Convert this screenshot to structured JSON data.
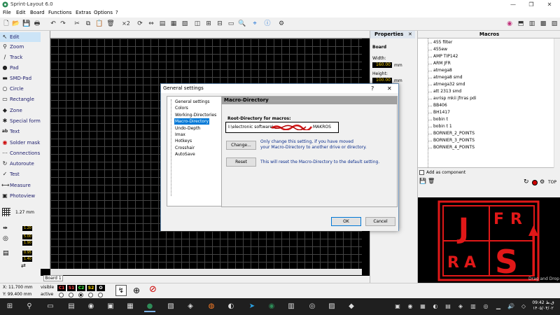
{
  "window": {
    "title": "Sprint-Layout 6.0"
  },
  "menu": [
    "File",
    "Edit",
    "Board",
    "Functions",
    "Extras",
    "Options",
    "?"
  ],
  "toolbar": {
    "zoom_factor": "×2"
  },
  "tools": [
    {
      "label": "Edit",
      "icon": "↖"
    },
    {
      "label": "Zoom",
      "icon": "⚲"
    },
    {
      "label": "Track",
      "icon": "∕"
    },
    {
      "label": "Pad",
      "icon": "●"
    },
    {
      "label": "SMD-Pad",
      "icon": "▬"
    },
    {
      "label": "Circle",
      "icon": "○"
    },
    {
      "label": "Rectangle",
      "icon": "▭"
    },
    {
      "label": "Zone",
      "icon": "◆"
    },
    {
      "label": "Special form",
      "icon": "✱"
    },
    {
      "label": "Text",
      "icon": "ab"
    },
    {
      "label": "Solder mask",
      "icon": "◉"
    },
    {
      "label": "Connections",
      "icon": "⋯"
    },
    {
      "label": "Autoroute",
      "icon": "↻"
    },
    {
      "label": "Test",
      "icon": "✓"
    },
    {
      "label": "Measure",
      "icon": "⟷"
    },
    {
      "label": "Photoview",
      "icon": "▣"
    }
  ],
  "grid": {
    "value": "1.27 mm"
  },
  "tool_values": [
    "1.20",
    "5.00",
    "1.90",
    "0.95",
    "1.40"
  ],
  "ruler": {
    "unit": "mm"
  },
  "properties": {
    "title": "Properties",
    "section": "Board",
    "width_label": "Width:",
    "width_value": "160.00",
    "height_label": "Height:",
    "height_value": "100.00",
    "unit": "mm"
  },
  "macros": {
    "title": "Macros",
    "items": [
      "455 filter",
      "455ew",
      "AMP TIP142",
      "ARM JFR",
      "atmega8",
      "atmega8 smd",
      "atmega32 smd",
      "att 2313 smd",
      "avrisp mkii jfrras pdi",
      "BB406",
      "BH1417",
      "bobin t",
      "bobin t 1",
      "BORNIER_2_POINTS",
      "BORNIER_3_POINTS",
      "BORNIER_4_POINTS"
    ],
    "add_component": "Add as component",
    "top_label": "TOP",
    "drag_drop": "Drag and Drop",
    "preview_letters": [
      "J",
      "F",
      "R",
      "R",
      "A",
      "S"
    ]
  },
  "status": {
    "x": "X:    11.700 mm",
    "y": "Y:    99.400 mm",
    "visible": "visible",
    "active": "active",
    "layers": [
      {
        "name": "C1",
        "color": "#ff4040"
      },
      {
        "name": "S1",
        "color": "#ff4040"
      },
      {
        "name": "C2",
        "color": "#40ff40"
      },
      {
        "name": "S2",
        "color": "#ffd700"
      },
      {
        "name": "O",
        "color": "#ffffff"
      }
    ]
  },
  "board_tab": "Board 1",
  "dialog": {
    "title": "General settings",
    "help": "?",
    "close": "✕",
    "nav": [
      "General settings",
      "Colors",
      "Working-Directories",
      "Macro-Directory",
      "Undo-Depth",
      "Imax",
      "Hotkeys",
      "Crosshair",
      "AutoSave"
    ],
    "selected_index": 3,
    "panel_title": "Macro-Directory",
    "root_label": "Root-Directory for macros:",
    "path_start": "I:\\electronic software\\",
    "path_end": "MAKROS",
    "change_button": "Change...",
    "change_note_1": "Only change this setting, if you have moved",
    "change_note_2": "your Macro-Directory to another drive or directory.",
    "reset_button": "Reset",
    "reset_note": "This will reset the Macro-Directory to the default setting.",
    "ok": "OK",
    "cancel": "Cancel"
  },
  "taskbar": {
    "time": "09:42 ق.ظ",
    "date": "۱۴۰۵/۰۴/۰۲"
  }
}
